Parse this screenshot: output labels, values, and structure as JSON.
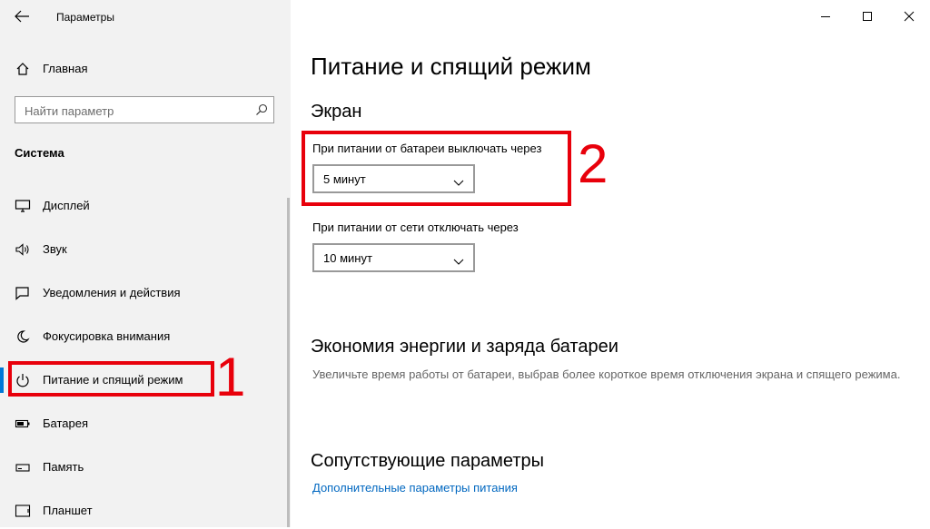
{
  "window": {
    "title": "Параметры"
  },
  "sidebar": {
    "home_label": "Главная",
    "search_placeholder": "Найти параметр",
    "section_label": "Система",
    "items": [
      {
        "label": "Дисплей",
        "icon": "monitor-icon"
      },
      {
        "label": "Звук",
        "icon": "speaker-icon"
      },
      {
        "label": "Уведомления и действия",
        "icon": "notification-icon"
      },
      {
        "label": "Фокусировка внимания",
        "icon": "moon-icon"
      },
      {
        "label": "Питание и спящий режим",
        "icon": "power-icon",
        "selected": true
      },
      {
        "label": "Батарея",
        "icon": "battery-icon"
      },
      {
        "label": "Память",
        "icon": "storage-icon"
      },
      {
        "label": "Планшет",
        "icon": "tablet-icon"
      }
    ]
  },
  "annotations": {
    "marker1": "1",
    "marker2": "2",
    "highlight_color": "#e8000b"
  },
  "main": {
    "title": "Питание и спящий режим",
    "screen_section": "Экран",
    "battery_off_label": "При питании от батареи выключать через",
    "battery_off_value": "5 минут",
    "ac_off_label": "При питании от сети отключать через",
    "ac_off_value": "10 минут",
    "saver_title": "Экономия энергии и заряда батареи",
    "saver_desc": "Увеличьте время работы от батареи, выбрав более короткое время отключения экрана и спящего режима.",
    "related_title": "Сопутствующие параметры",
    "related_link": "Дополнительные параметры питания"
  },
  "colors": {
    "accent": "#0078d7",
    "link": "#0067c0",
    "sidebar_bg": "#f2f2f2"
  }
}
